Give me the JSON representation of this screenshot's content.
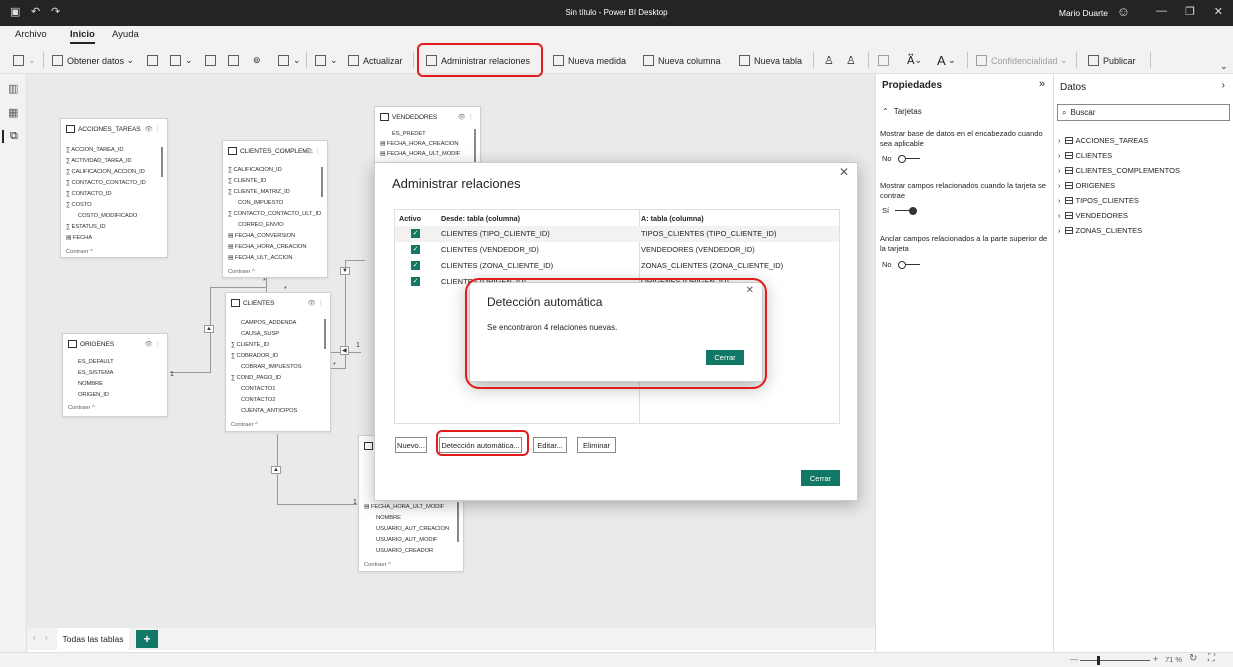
{
  "window": {
    "title": "Sin título - Power BI Desktop",
    "user": "Mario Duarte"
  },
  "menu": {
    "items": [
      "Archivo",
      "Inicio",
      "Ayuda"
    ],
    "active": "Inicio"
  },
  "ribbon": {
    "obtener_datos": "Obtener datos",
    "actualizar": "Actualizar",
    "administrar_relaciones": "Administrar relaciones",
    "nueva_medida": "Nueva medida",
    "nueva_columna": "Nueva columna",
    "nueva_tabla": "Nueva tabla",
    "confidencialidad": "Confidencialidad",
    "publicar": "Publicar"
  },
  "tables": [
    {
      "name": "ACCIONES_TAREAS",
      "fields": [
        "ACCION_TAREA_ID",
        "ACTIVIDAD_TAREA_ID",
        "CALIFICACION_ACCION_ID",
        "CONTACTO_CONTACTO_ID",
        "CONTACTO_ID",
        "COSTO",
        "COSTO_MODIFICADO",
        "ESTATUS_ID",
        "FECHA"
      ],
      "collapse": "Contraer ^"
    },
    {
      "name": "CLIENTES_COMPLEM...",
      "fields": [
        "CALIFICACION_ID",
        "CLIENTE_ID",
        "CLIENTE_MATRIZ_ID",
        "CON_IMPUESTO",
        "CONTACTO_CONTACTO_ULT_ID",
        "CORREO_ENVIO",
        "FECHA_CONVERSION",
        "FECHA_HORA_CREACION",
        "FECHA_ULT_ACCION"
      ],
      "collapse": "Contraer ^"
    },
    {
      "name": "VENDEDORES",
      "fields": [
        "ES_PREDET",
        "FECHA_HORA_CREACION",
        "FECHA_HORA_ULT_MODIF"
      ]
    },
    {
      "name": "CLIENTES",
      "fields": [
        "CAMPOS_ADDENDA",
        "CAUSA_SUSP",
        "CLIENTE_ID",
        "COBRADOR_ID",
        "COBRAR_IMPUESTOS",
        "COND_PAGO_ID",
        "CONTACTO1",
        "CONTACTO2",
        "CUENTA_ANTICIPOS"
      ],
      "collapse": "Contraer ^"
    },
    {
      "name": "ORIGENES",
      "fields": [
        "ES_DEFAULT",
        "ES_SISTEMA",
        "NOMBRE",
        "ORIGEN_ID"
      ],
      "collapse": "Contraer ^"
    },
    {
      "name": "",
      "fields": [
        "FECHA_HORA_ULT_MODIF",
        "NOMBRE",
        "USUARIO_AUT_CREACION",
        "USUARIO_AUT_MODIF",
        "USUARIO_CREADOR"
      ],
      "collapse": "Contraer ^"
    }
  ],
  "cardinality": {
    "many": "*",
    "one": "1"
  },
  "bottom": {
    "tab": "Todas las tablas",
    "add": "+"
  },
  "status": {
    "zoom": "71 %"
  },
  "properties": {
    "title": "Propiedades",
    "section": "Tarjetas",
    "items": [
      {
        "label": "Mostrar base de datos en el encabezado cuando sea aplicable",
        "value": "No",
        "on": false
      },
      {
        "label": "Mostrar campos relacionados cuando la tarjeta se contrae",
        "value": "Sí",
        "on": true
      },
      {
        "label": "Anclar campos relacionados a la parte superior de la tarjeta",
        "value": "No",
        "on": false
      }
    ]
  },
  "datos": {
    "title": "Datos",
    "search_placeholder": "Buscar",
    "tables": [
      "ACCIONES_TAREAS",
      "CLIENTES",
      "CLIENTES_COMPLEMENTOS",
      "ORIGENES",
      "TIPOS_CLIENTES",
      "VENDEDORES",
      "ZONAS_CLIENTES"
    ]
  },
  "manage_dialog": {
    "title": "Administrar relaciones",
    "col_active": "Activo",
    "col_from": "Desde: tabla (columna)",
    "col_to": "A: tabla (columna)",
    "rows": [
      {
        "from": "CLIENTES (TIPO_CLIENTE_ID)",
        "to": "TIPOS_CLIENTES (TIPO_CLIENTE_ID)"
      },
      {
        "from": "CLIENTES (VENDEDOR_ID)",
        "to": "VENDEDORES (VENDEDOR_ID)"
      },
      {
        "from": "CLIENTES (ZONA_CLIENTE_ID)",
        "to": "ZONAS_CLIENTES (ZONA_CLIENTE_ID)"
      },
      {
        "from": "CLIENTES (ORIGEN_ID)",
        "to": "ORIGENES (ORIGEN_ID)"
      }
    ],
    "buttons": {
      "new": "Nuevo...",
      "autodetect": "Detección automática...",
      "edit": "Editar...",
      "delete": "Eliminar",
      "close": "Cerrar"
    }
  },
  "autodetect_dialog": {
    "title": "Detección automática",
    "message": "Se encontraron 4 relaciones nuevas.",
    "close": "Cerrar"
  }
}
